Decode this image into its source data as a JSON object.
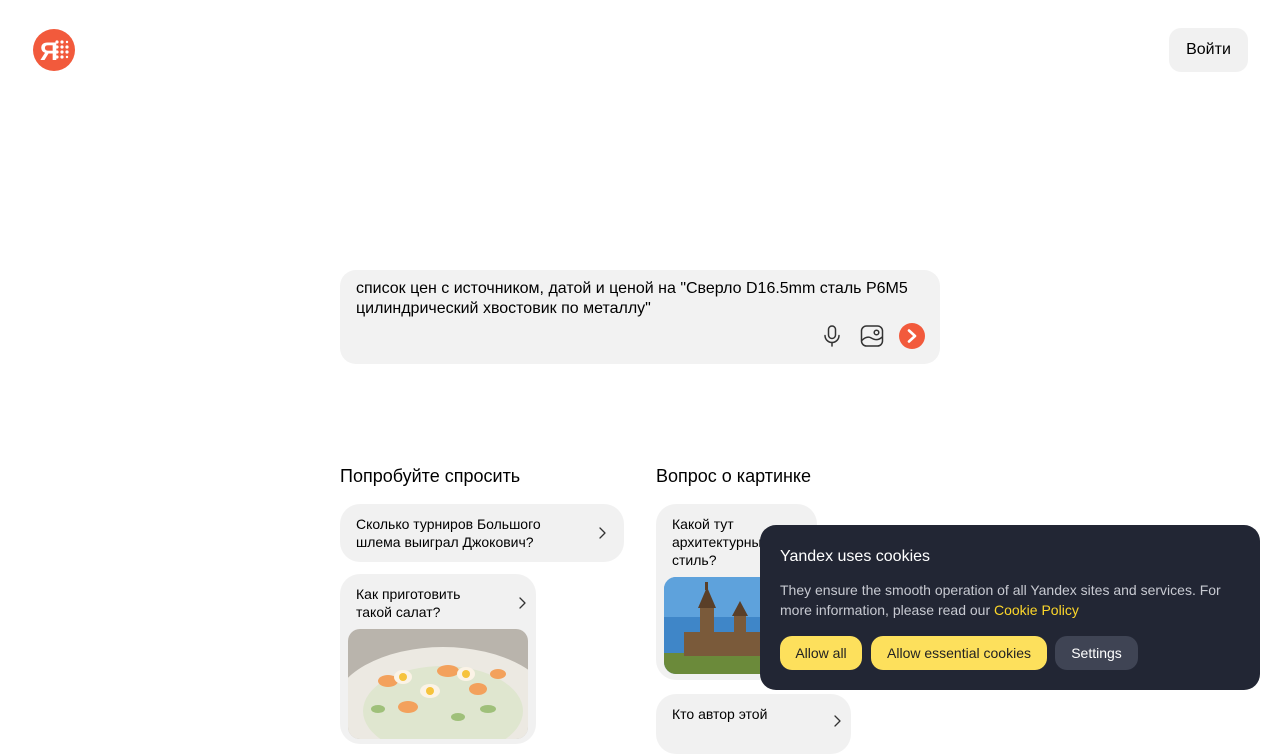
{
  "header": {
    "login_label": "Войти"
  },
  "search": {
    "query": "список цен с источником, датой и ценой на \"Сверло D16.5mm сталь Р6М5 цилиндрический хвостовик по металлу\""
  },
  "suggestions": {
    "try_asking": {
      "title": "Попробуйте спросить",
      "items": [
        {
          "text": "Сколько турниров Большого шлема выиграл Джокович?"
        },
        {
          "text": "Как приготовить такой салат?"
        }
      ]
    },
    "image_question": {
      "title": "Вопрос о картинке",
      "items": [
        {
          "text": "Какой тут архитектурный стиль?"
        },
        {
          "text": "Кто автор этой"
        }
      ]
    }
  },
  "cookie_banner": {
    "title": "Yandex uses cookies",
    "body": "They ensure the smooth operation of all Yandex sites and services. For more information, please read our ",
    "link": "Cookie Policy",
    "buttons": {
      "allow_all": "Allow all",
      "allow_essential": "Allow essential cookies",
      "settings": "Settings"
    }
  },
  "colors": {
    "brand": "#f25a3c",
    "cookie_bg": "#222634",
    "cookie_accent": "#fdd72a"
  }
}
